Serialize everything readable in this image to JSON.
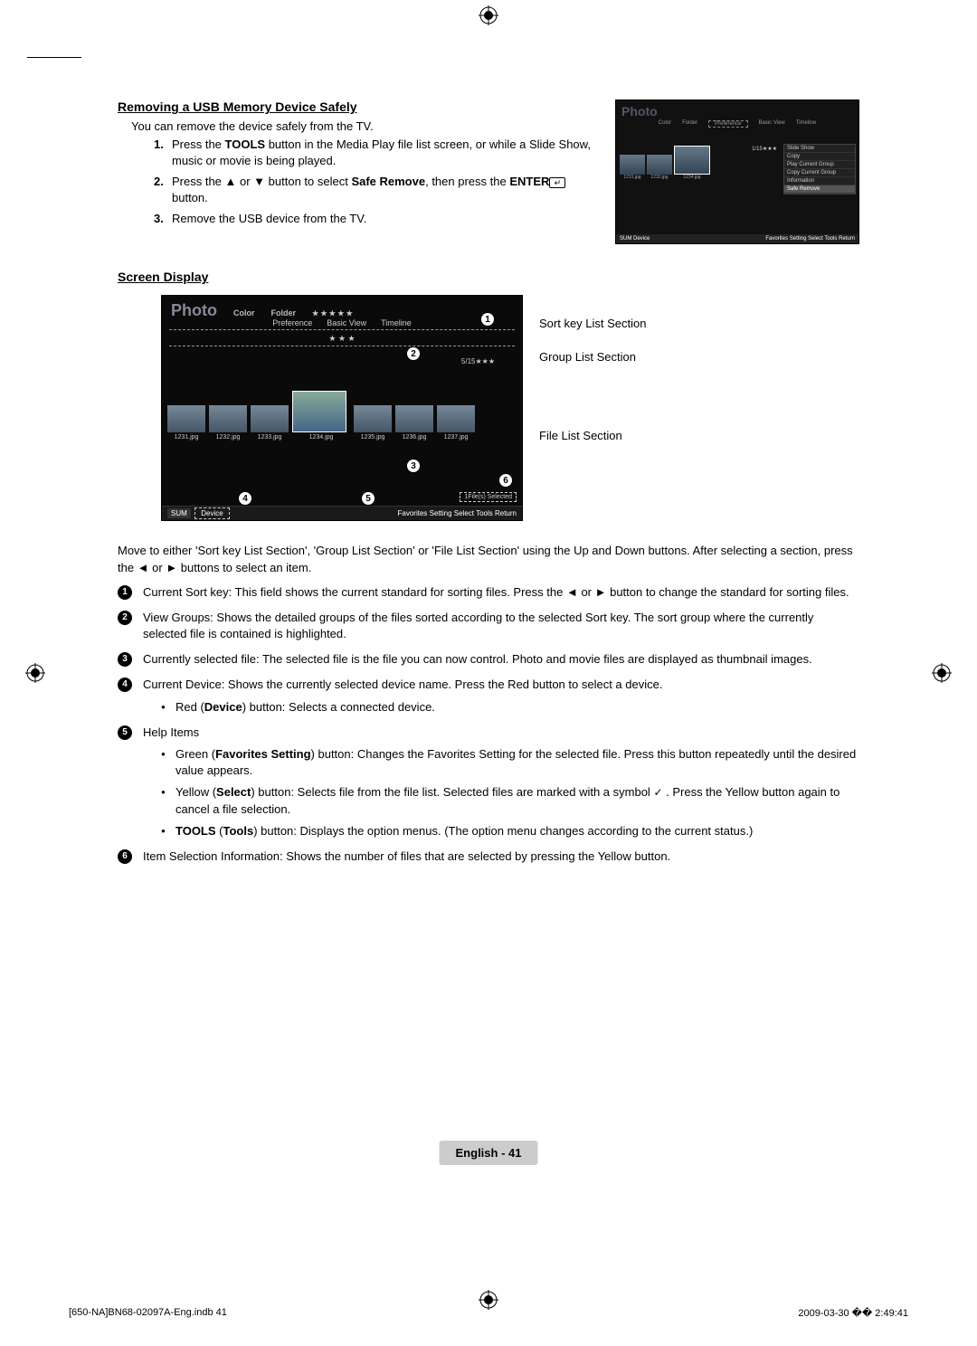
{
  "section1": {
    "title": "Removing a USB Memory Device Safely",
    "intro": "You can remove the device safely from the TV.",
    "steps": [
      {
        "n": "1.",
        "pre": "Press the ",
        "b1": "TOOLS",
        "post": " button in the Media Play file list screen, or while a Slide Show, music or movie is being played."
      },
      {
        "n": "2.",
        "pre": "Press the ▲ or ▼ button to select ",
        "b1": "Safe Remove",
        "mid": ", then press the ",
        "b2": "ENTER",
        "post": " button."
      },
      {
        "n": "3.",
        "pre": "Remove the USB device from the TV."
      }
    ]
  },
  "topimg": {
    "title": "Photo",
    "tabs": [
      "Color",
      "Folder",
      "Preference",
      "Basic View",
      "Timeline"
    ],
    "caps": [
      "1231.jpg",
      "1232.jpg",
      "",
      "1234.jpg"
    ],
    "menu": [
      "Slide Show",
      "Copy",
      "Play Current Group",
      "Copy Current Group",
      "Information",
      "Safe Remove"
    ],
    "barL": "SUM    Device",
    "barR": "Favorites Setting    Select    Tools    Return",
    "count": "1/15★★★"
  },
  "section2": {
    "title": "Screen Display",
    "labels": {
      "l1": "Sort key List Section",
      "l2": "Group List Section",
      "l3": "File List Section"
    }
  },
  "bigimg": {
    "title": "Photo",
    "tabs": [
      "Color",
      "Folder",
      "Preference",
      "Basic View",
      "Timeline"
    ],
    "tab_active": "Preference",
    "stars": "★ ★ ★ ★ ★",
    "midstars": "★ ★ ★",
    "count": "5/15★★★",
    "files": [
      "1231.jpg",
      "1232.jpg",
      "1233.jpg",
      "1234.jpg",
      "1235.jpg",
      "1236.jpg",
      "1237.jpg"
    ],
    "selbox": "1File(s) Selected",
    "sum": "SUM",
    "device": "Device",
    "barR": "Favorites Setting    Select    Tools    Return"
  },
  "circles": {
    "c1": "1",
    "c2": "2",
    "c3": "3",
    "c4": "4",
    "c5": "5",
    "c6": "6"
  },
  "para": "Move to either 'Sort key List Section', 'Group List Section' or 'File List Section' using the Up and Down buttons. After selecting a section, press the ◄ or ► buttons to select an item.",
  "items": {
    "i1": "Current Sort key: This field shows the current standard for sorting files. Press the ◄ or ► button to change the standard for sorting files.",
    "i2": "View Groups: Shows the detailed groups of the files sorted according to the selected Sort key. The sort group where the currently selected file is contained is highlighted.",
    "i3": "Currently selected file: The selected file is the file you can now control. Photo and movie files are displayed as thumbnail images.",
    "i4": "Current Device: Shows the currently selected device name. Press the Red button to select a device.",
    "i4b_pre": "Red (",
    "i4b_b": "Device",
    "i4b_post": ") button: Selects a connected device.",
    "i5": "Help Items",
    "i5a_pre": "Green (",
    "i5a_b": "Favorites Setting",
    "i5a_post": ") button: Changes the Favorites Setting for the selected file. Press this button repeatedly until the desired value appears.",
    "i5b_pre": "Yellow (",
    "i5b_b": "Select",
    "i5b_mid": ") button: Selects file from the file list. Selected files are marked with a symbol ",
    "i5b_post": " . Press the Yellow button again to cancel a file selection.",
    "i5c_b1": "TOOLS",
    "i5c_mid1": " (",
    "i5c_b2": "Tools",
    "i5c_post": ") button: Displays the option menus. (The option menu changes according to the current status.)",
    "i6": "Item Selection Information: Shows the number of files that are selected by pressing the Yellow button."
  },
  "footer": {
    "center": "English - 41",
    "left": "[650-NA]BN68-02097A-Eng.indb   41",
    "right": "2009-03-30   �� 2:49:41"
  }
}
